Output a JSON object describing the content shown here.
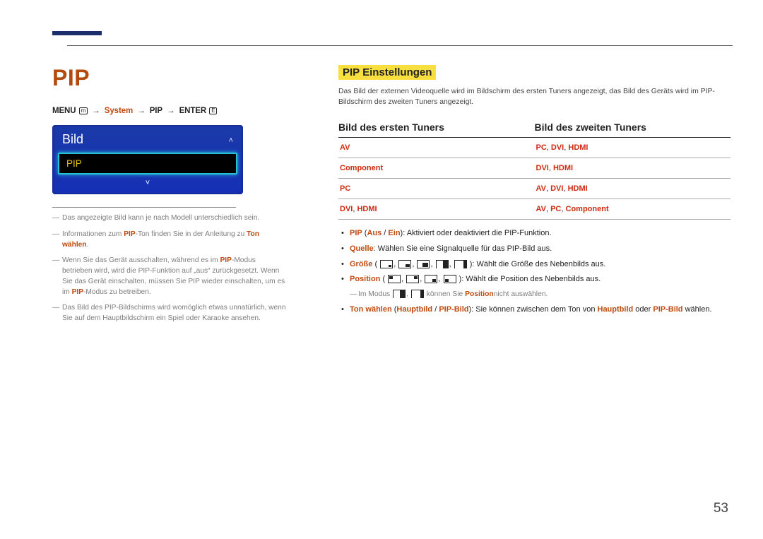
{
  "page_number": "53",
  "left": {
    "title": "PIP",
    "breadcrumb": {
      "menu": "MENU",
      "menu_icon": "m",
      "arrow": "→",
      "system": "System",
      "pip": "PIP",
      "enter": "ENTER",
      "enter_icon": "E"
    },
    "tv_menu": {
      "header": "Bild",
      "item": "PIP"
    },
    "notes": {
      "n1": "Das angezeigte Bild kann je nach Modell unterschiedlich sein.",
      "n2_a": "Informationen zum ",
      "n2_pip": "PIP",
      "n2_b": "-Ton finden Sie in der Anleitung zu ",
      "n2_ton": "Ton wählen",
      "n2_c": ".",
      "n3_a": "Wenn Sie das Gerät ausschalten, während es im ",
      "n3_pip": "PIP",
      "n3_b": "-Modus betrieben wird, wird die PIP-Funktion auf „aus“ zurückgesetzt. Wenn Sie das Gerät einschalten, müssen Sie PIP wieder einschalten, um es im ",
      "n3_pip2": "PIP",
      "n3_c": "-Modus zu betreiben.",
      "n4": "Das Bild des PIP-Bildschirms wird womöglich etwas unnatürlich, wenn Sie auf dem Hauptbildschirm ein Spiel oder Karaoke ansehen."
    }
  },
  "right": {
    "heading": "PIP Einstellungen",
    "intro": "Das Bild der externen Videoquelle wird im Bildschirm des ersten Tuners angezeigt, das Bild des Geräts wird im PIP-Bildschirm des zweiten Tuners angezeigt.",
    "tbl": {
      "h1": "Bild des ersten Tuners",
      "h2": "Bild des zweiten Tuners",
      "rows": [
        {
          "l": [
            "AV"
          ],
          "r": [
            "PC",
            "DVI",
            "HDMI"
          ]
        },
        {
          "l": [
            "Component"
          ],
          "r": [
            "DVI",
            "HDMI"
          ]
        },
        {
          "l": [
            "PC"
          ],
          "r": [
            "AV",
            "DVI",
            "HDMI"
          ]
        },
        {
          "l": [
            "DVI",
            "HDMI"
          ],
          "r": [
            "AV",
            "PC",
            "Component"
          ]
        }
      ]
    },
    "bul": {
      "b1_pip": "PIP",
      "b1_paren": " (",
      "b1_aus": "Aus",
      "b1_slash": " / ",
      "b1_ein": "Ein",
      "b1_tail": "): Aktiviert oder deaktiviert die PIP-Funktion.",
      "b2_q": "Quelle",
      "b2_tail": ": Wählen Sie eine Signalquelle für das PIP-Bild aus.",
      "b3_g": "Größe",
      "b3_tail": ": Wählt die Größe des Nebenbilds aus.",
      "b4_p": "Position",
      "b4_tail": ": Wählt die Position des Nebenbilds aus.",
      "sub_a": "Im Modus ",
      "sub_b": " können Sie ",
      "sub_pos": "Position",
      "sub_c": "nicht auswählen.",
      "b5_t": "Ton wählen",
      "b5_a": " (",
      "b5_h": "Hauptbild",
      "b5_s": " / ",
      "b5_p": "PIP-Bild",
      "b5_b": "): Sie können zwischen dem Ton von ",
      "b5_h2": "Hauptbild",
      "b5_o": " oder ",
      "b5_p2": "PIP-Bild",
      "b5_w": " wählen."
    }
  }
}
